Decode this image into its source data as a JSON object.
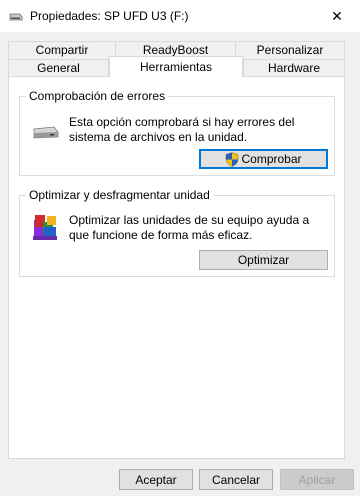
{
  "window": {
    "title": "Propiedades: SP UFD U3 (F:)",
    "close_glyph": "✕"
  },
  "tabs": {
    "row1": [
      {
        "label": "Compartir"
      },
      {
        "label": "ReadyBoost"
      },
      {
        "label": "Personalizar"
      }
    ],
    "row2": [
      {
        "label": "General"
      },
      {
        "label": "Herramientas",
        "selected": true
      },
      {
        "label": "Hardware"
      }
    ]
  },
  "error_check": {
    "title": "Comprobación de errores",
    "description": "Esta opción comprobará si hay errores del sistema de archivos en la unidad.",
    "button_label": "Comprobar",
    "icon": "drive-icon"
  },
  "optimize": {
    "title": "Optimizar y desfragmentar unidad",
    "description": "Optimizar las unidades de su equipo ayuda a que funcione de forma más eficaz.",
    "button_label": "Optimizar",
    "icon": "defrag-icon"
  },
  "footer": {
    "accept_label": "Aceptar",
    "cancel_label": "Cancelar",
    "apply_label": "Aplicar"
  },
  "colors": {
    "accent": "#0078d7",
    "window_bg": "#f0f0f0",
    "panel_bg": "#ffffff"
  }
}
